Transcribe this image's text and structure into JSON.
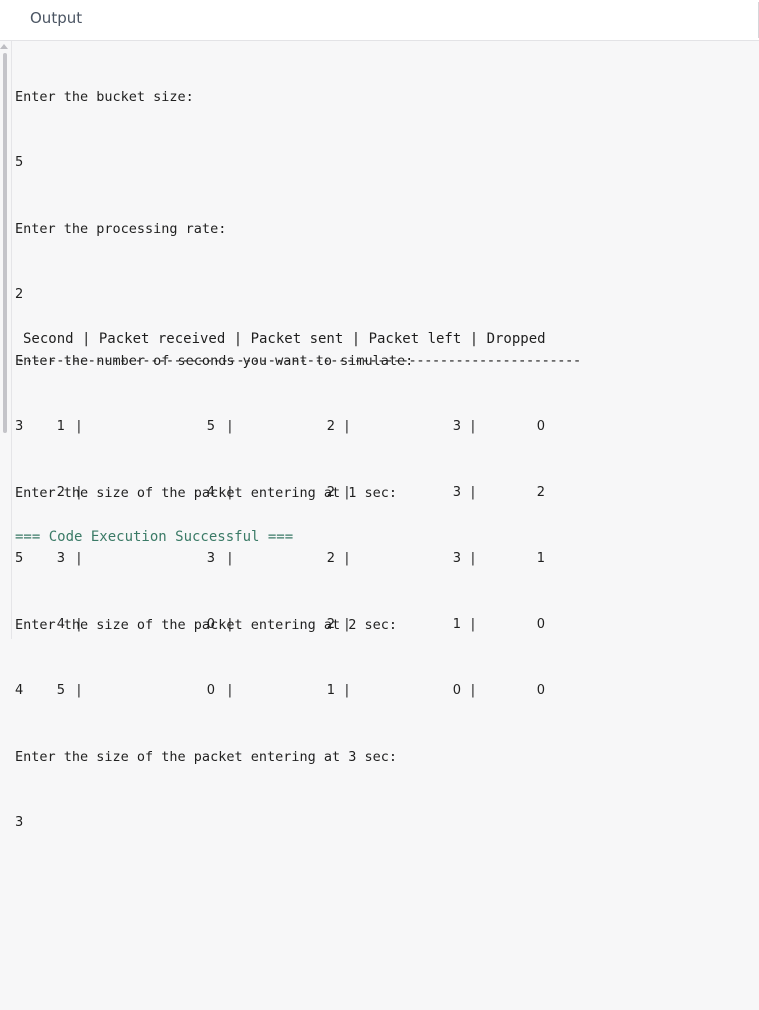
{
  "header": {
    "title": "Output"
  },
  "console": {
    "lines": [
      {
        "prompt": "Enter the bucket size:",
        "value": "5"
      },
      {
        "prompt": "Enter the processing rate:",
        "value": "2"
      },
      {
        "prompt": "Enter the number of seconds you want to simulate:",
        "value": "3"
      },
      {
        "prompt": "Enter the size of the packet entering at 1 sec:",
        "value": "5"
      },
      {
        "prompt": "Enter the size of the packet entering at 2 sec:",
        "value": "4"
      },
      {
        "prompt": "Enter the size of the packet entering at 3 sec:",
        "value": "3"
      }
    ],
    "table_header": "Second | Packet received | Packet sent | Packet left | Dropped",
    "separator": "------------------------------------------------------------------------",
    "rows": [
      {
        "second": "1",
        "received": "5",
        "sent": "2",
        "left": "3",
        "dropped": "0"
      },
      {
        "second": "2",
        "received": "4",
        "sent": "2",
        "left": "3",
        "dropped": "2"
      },
      {
        "second": "3",
        "received": "3",
        "sent": "2",
        "left": "3",
        "dropped": "1"
      },
      {
        "second": "4",
        "received": "0",
        "sent": "2",
        "left": "1",
        "dropped": "0"
      },
      {
        "second": "5",
        "received": "0",
        "sent": "1",
        "left": "0",
        "dropped": "0"
      }
    ],
    "status": "=== Code Execution Successful ==="
  }
}
